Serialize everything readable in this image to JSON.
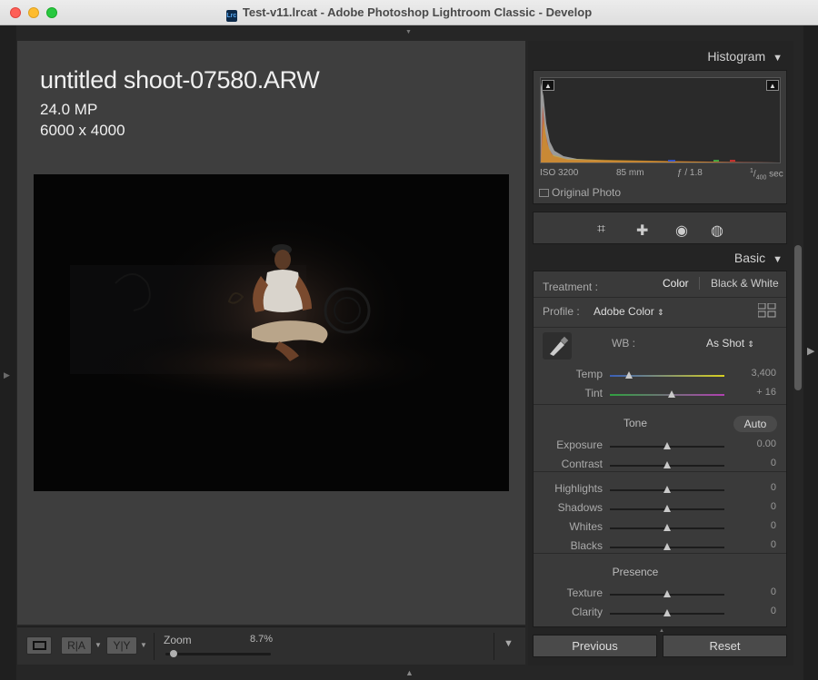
{
  "window": {
    "title": "Test-v11.lrcat - Adobe Photoshop Lightroom Classic - Develop",
    "app_icon_text": "Lrc"
  },
  "photo_info": {
    "filename": "untitled shoot-07580.ARW",
    "megapixels": "24.0 MP",
    "dimensions": "6000 x 4000"
  },
  "toolbar": {
    "view_icon": "loupe-view-icon",
    "ra_label": "R|A",
    "yy_label": "Y|Y",
    "zoom_label": "Zoom",
    "zoom_value": "8.7%",
    "zoom_fraction": 0.05
  },
  "histogram": {
    "title": "Histogram",
    "iso": "ISO 3200",
    "focal": "85 mm",
    "aperture": "ƒ / 1.8",
    "shutter_num": "1",
    "shutter_den": "400",
    "shutter_unit": "sec",
    "original_photo": "Original Photo"
  },
  "tools": [
    "crop-icon",
    "healing-icon",
    "red-eye-icon",
    "masking-icon"
  ],
  "basic": {
    "title": "Basic",
    "treatment_label": "Treatment :",
    "color": "Color",
    "bw": "Black & White",
    "profile_label": "Profile :",
    "profile_value": "Adobe Color",
    "wb_label": "WB :",
    "wb_value": "As Shot",
    "temp": {
      "label": "Temp",
      "value": "3,400",
      "fraction": 0.17
    },
    "tint": {
      "label": "Tint",
      "value": "+ 16",
      "fraction": 0.54
    },
    "tone_title": "Tone",
    "auto": "Auto",
    "exposure": {
      "label": "Exposure",
      "value": "0.00",
      "fraction": 0.5
    },
    "contrast": {
      "label": "Contrast",
      "value": "0",
      "fraction": 0.5
    },
    "highlights": {
      "label": "Highlights",
      "value": "0",
      "fraction": 0.5
    },
    "shadows": {
      "label": "Shadows",
      "value": "0",
      "fraction": 0.5
    },
    "whites": {
      "label": "Whites",
      "value": "0",
      "fraction": 0.5
    },
    "blacks": {
      "label": "Blacks",
      "value": "0",
      "fraction": 0.5
    },
    "presence_title": "Presence",
    "texture": {
      "label": "Texture",
      "value": "0",
      "fraction": 0.5
    },
    "clarity": {
      "label": "Clarity",
      "value": "0",
      "fraction": 0.5
    }
  },
  "buttons": {
    "previous": "Previous",
    "reset": "Reset"
  },
  "colors": {
    "panel_bg": "#3a3a3a",
    "loupe_bg": "#3e3e3e",
    "text": "#aaaaaa"
  }
}
